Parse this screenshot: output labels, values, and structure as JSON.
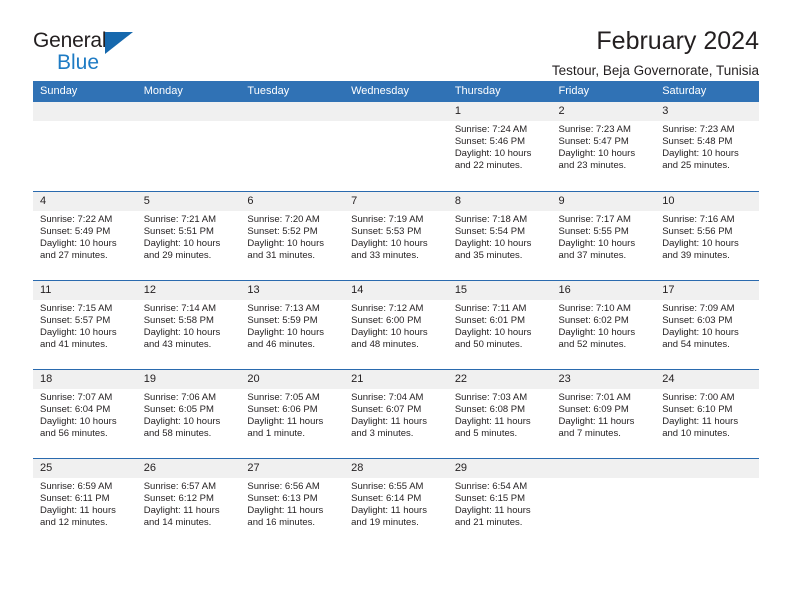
{
  "brand": {
    "name_top": "General",
    "name_bottom": "Blue",
    "accent_color": "#1668ad",
    "text_color": "#1e7bc4"
  },
  "header": {
    "title": "February 2024",
    "subtitle": "Testour, Beja Governorate, Tunisia",
    "header_bg": "#3072b5",
    "row_divider": "#2a6aae",
    "daynum_bg": "#f0f0f0"
  },
  "calendar": {
    "weekday_headers": [
      "Sunday",
      "Monday",
      "Tuesday",
      "Wednesday",
      "Thursday",
      "Friday",
      "Saturday"
    ],
    "weeks": [
      [
        {
          "day": "",
          "empty": true
        },
        {
          "day": "",
          "empty": true
        },
        {
          "day": "",
          "empty": true
        },
        {
          "day": "",
          "empty": true
        },
        {
          "day": "1",
          "sunrise": "Sunrise: 7:24 AM",
          "sunset": "Sunset: 5:46 PM",
          "daylight": "Daylight: 10 hours and 22 minutes."
        },
        {
          "day": "2",
          "sunrise": "Sunrise: 7:23 AM",
          "sunset": "Sunset: 5:47 PM",
          "daylight": "Daylight: 10 hours and 23 minutes."
        },
        {
          "day": "3",
          "sunrise": "Sunrise: 7:23 AM",
          "sunset": "Sunset: 5:48 PM",
          "daylight": "Daylight: 10 hours and 25 minutes."
        }
      ],
      [
        {
          "day": "4",
          "sunrise": "Sunrise: 7:22 AM",
          "sunset": "Sunset: 5:49 PM",
          "daylight": "Daylight: 10 hours and 27 minutes."
        },
        {
          "day": "5",
          "sunrise": "Sunrise: 7:21 AM",
          "sunset": "Sunset: 5:51 PM",
          "daylight": "Daylight: 10 hours and 29 minutes."
        },
        {
          "day": "6",
          "sunrise": "Sunrise: 7:20 AM",
          "sunset": "Sunset: 5:52 PM",
          "daylight": "Daylight: 10 hours and 31 minutes."
        },
        {
          "day": "7",
          "sunrise": "Sunrise: 7:19 AM",
          "sunset": "Sunset: 5:53 PM",
          "daylight": "Daylight: 10 hours and 33 minutes."
        },
        {
          "day": "8",
          "sunrise": "Sunrise: 7:18 AM",
          "sunset": "Sunset: 5:54 PM",
          "daylight": "Daylight: 10 hours and 35 minutes."
        },
        {
          "day": "9",
          "sunrise": "Sunrise: 7:17 AM",
          "sunset": "Sunset: 5:55 PM",
          "daylight": "Daylight: 10 hours and 37 minutes."
        },
        {
          "day": "10",
          "sunrise": "Sunrise: 7:16 AM",
          "sunset": "Sunset: 5:56 PM",
          "daylight": "Daylight: 10 hours and 39 minutes."
        }
      ],
      [
        {
          "day": "11",
          "sunrise": "Sunrise: 7:15 AM",
          "sunset": "Sunset: 5:57 PM",
          "daylight": "Daylight: 10 hours and 41 minutes."
        },
        {
          "day": "12",
          "sunrise": "Sunrise: 7:14 AM",
          "sunset": "Sunset: 5:58 PM",
          "daylight": "Daylight: 10 hours and 43 minutes."
        },
        {
          "day": "13",
          "sunrise": "Sunrise: 7:13 AM",
          "sunset": "Sunset: 5:59 PM",
          "daylight": "Daylight: 10 hours and 46 minutes."
        },
        {
          "day": "14",
          "sunrise": "Sunrise: 7:12 AM",
          "sunset": "Sunset: 6:00 PM",
          "daylight": "Daylight: 10 hours and 48 minutes."
        },
        {
          "day": "15",
          "sunrise": "Sunrise: 7:11 AM",
          "sunset": "Sunset: 6:01 PM",
          "daylight": "Daylight: 10 hours and 50 minutes."
        },
        {
          "day": "16",
          "sunrise": "Sunrise: 7:10 AM",
          "sunset": "Sunset: 6:02 PM",
          "daylight": "Daylight: 10 hours and 52 minutes."
        },
        {
          "day": "17",
          "sunrise": "Sunrise: 7:09 AM",
          "sunset": "Sunset: 6:03 PM",
          "daylight": "Daylight: 10 hours and 54 minutes."
        }
      ],
      [
        {
          "day": "18",
          "sunrise": "Sunrise: 7:07 AM",
          "sunset": "Sunset: 6:04 PM",
          "daylight": "Daylight: 10 hours and 56 minutes."
        },
        {
          "day": "19",
          "sunrise": "Sunrise: 7:06 AM",
          "sunset": "Sunset: 6:05 PM",
          "daylight": "Daylight: 10 hours and 58 minutes."
        },
        {
          "day": "20",
          "sunrise": "Sunrise: 7:05 AM",
          "sunset": "Sunset: 6:06 PM",
          "daylight": "Daylight: 11 hours and 1 minute."
        },
        {
          "day": "21",
          "sunrise": "Sunrise: 7:04 AM",
          "sunset": "Sunset: 6:07 PM",
          "daylight": "Daylight: 11 hours and 3 minutes."
        },
        {
          "day": "22",
          "sunrise": "Sunrise: 7:03 AM",
          "sunset": "Sunset: 6:08 PM",
          "daylight": "Daylight: 11 hours and 5 minutes."
        },
        {
          "day": "23",
          "sunrise": "Sunrise: 7:01 AM",
          "sunset": "Sunset: 6:09 PM",
          "daylight": "Daylight: 11 hours and 7 minutes."
        },
        {
          "day": "24",
          "sunrise": "Sunrise: 7:00 AM",
          "sunset": "Sunset: 6:10 PM",
          "daylight": "Daylight: 11 hours and 10 minutes."
        }
      ],
      [
        {
          "day": "25",
          "sunrise": "Sunrise: 6:59 AM",
          "sunset": "Sunset: 6:11 PM",
          "daylight": "Daylight: 11 hours and 12 minutes."
        },
        {
          "day": "26",
          "sunrise": "Sunrise: 6:57 AM",
          "sunset": "Sunset: 6:12 PM",
          "daylight": "Daylight: 11 hours and 14 minutes."
        },
        {
          "day": "27",
          "sunrise": "Sunrise: 6:56 AM",
          "sunset": "Sunset: 6:13 PM",
          "daylight": "Daylight: 11 hours and 16 minutes."
        },
        {
          "day": "28",
          "sunrise": "Sunrise: 6:55 AM",
          "sunset": "Sunset: 6:14 PM",
          "daylight": "Daylight: 11 hours and 19 minutes."
        },
        {
          "day": "29",
          "sunrise": "Sunrise: 6:54 AM",
          "sunset": "Sunset: 6:15 PM",
          "daylight": "Daylight: 11 hours and 21 minutes."
        },
        {
          "day": "",
          "empty": true
        },
        {
          "day": "",
          "empty": true
        }
      ]
    ]
  }
}
